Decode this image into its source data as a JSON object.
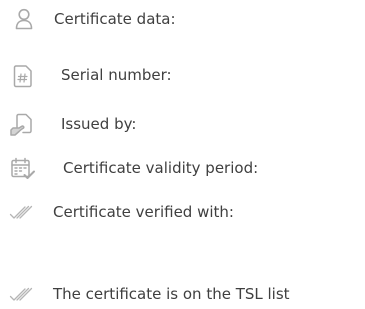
{
  "fields": {
    "certificate_data": "Certificate data:",
    "serial_number": "Serial number:",
    "issued_by": "Issued by:",
    "validity_period": "Certificate validity period:",
    "verified_with": "Certificate verified with:",
    "tsl_status": "The certificate is on the TSL list"
  },
  "icons": {
    "certificate_data": "user-icon",
    "serial_number": "hash-document-icon",
    "issued_by": "hand-document-icon",
    "validity_period": "calendar-check-icon",
    "verified_with": "double-check-icon",
    "tsl_status": "double-check-icon"
  },
  "colors": {
    "icon": "#a9a9a9",
    "text": "#3f3f3f"
  }
}
